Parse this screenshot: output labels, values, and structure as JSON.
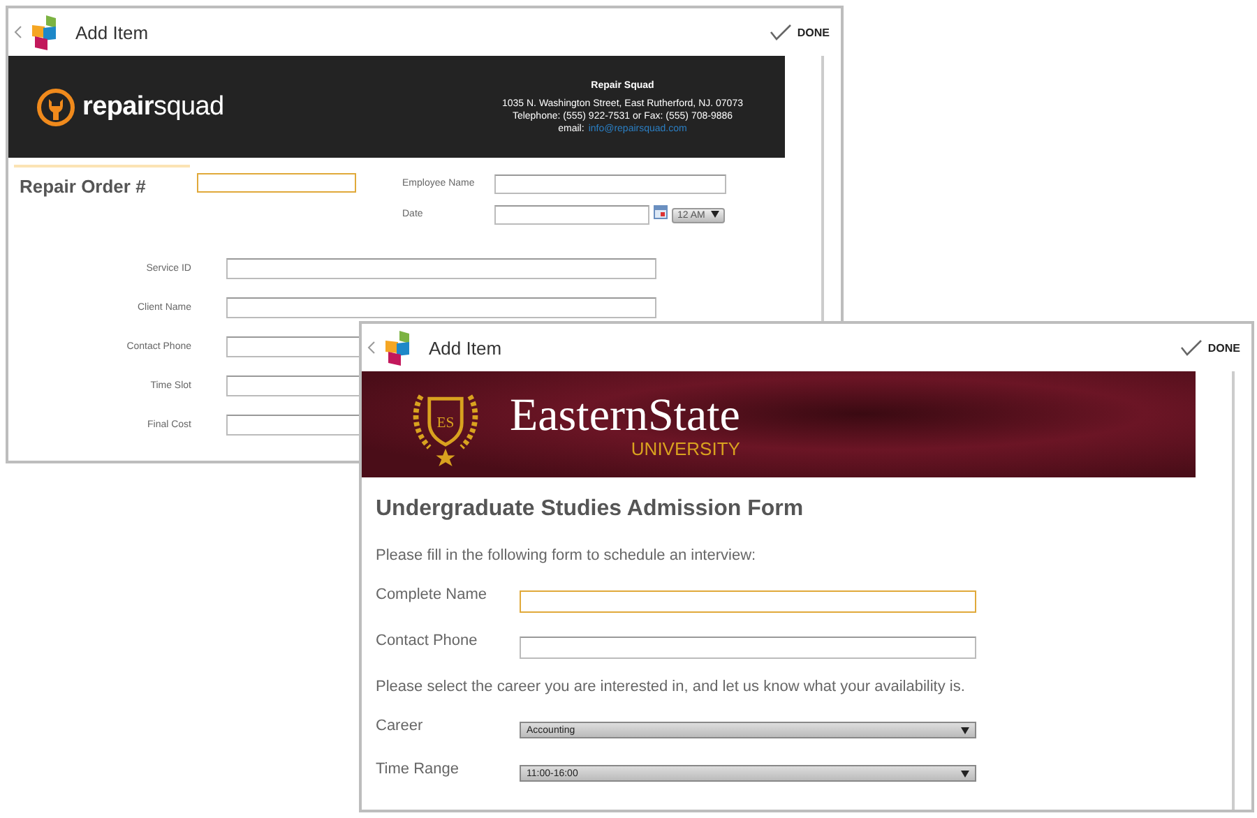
{
  "back_window": {
    "title": "Add Item",
    "done": "DONE",
    "banner": {
      "logo_bold": "repair",
      "logo_light": "squad",
      "company": "Repair Squad",
      "address": "1035 N. Washington Street, East Rutherford, NJ. 07073",
      "phone": "Telephone: (555) 922-7531 or Fax: (555) 708-9886",
      "email_label": "email:",
      "email": "info@repairsquad.com"
    },
    "order": {
      "label": "Repair Order #",
      "focused": true
    },
    "side_fields": [
      {
        "label": "Employee Name",
        "kind": "text",
        "focused": false
      },
      {
        "label": "Date",
        "kind": "date",
        "time": "12 AM",
        "focused": false
      }
    ],
    "fields": [
      {
        "label": "Service ID",
        "focused": false
      },
      {
        "label": "Client Name",
        "focused": false
      },
      {
        "label": "Contact Phone",
        "focused": false
      },
      {
        "label": "Time Slot",
        "focused": false
      },
      {
        "label": "Final Cost",
        "focused": false
      }
    ]
  },
  "front_window": {
    "title": "Add Item",
    "done": "DONE",
    "banner": {
      "crest_initials": "ES",
      "name": "EasternState",
      "subtitle": "UNIVERSITY"
    },
    "heading": "Undergraduate Studies Admission Form",
    "sections": [
      {
        "kind": "text",
        "text": "Please fill in the following form to schedule an interview:"
      },
      {
        "kind": "input",
        "label": "Complete Name",
        "focused": true
      },
      {
        "kind": "input",
        "label": "Contact Phone",
        "focused": false
      },
      {
        "kind": "text",
        "text": "Please select the career you are interested in, and let us know what your availability is."
      },
      {
        "kind": "select",
        "label": "Career",
        "value": "Accounting"
      },
      {
        "kind": "select",
        "label": "Time Range",
        "value": "11:00-16:00"
      }
    ]
  }
}
